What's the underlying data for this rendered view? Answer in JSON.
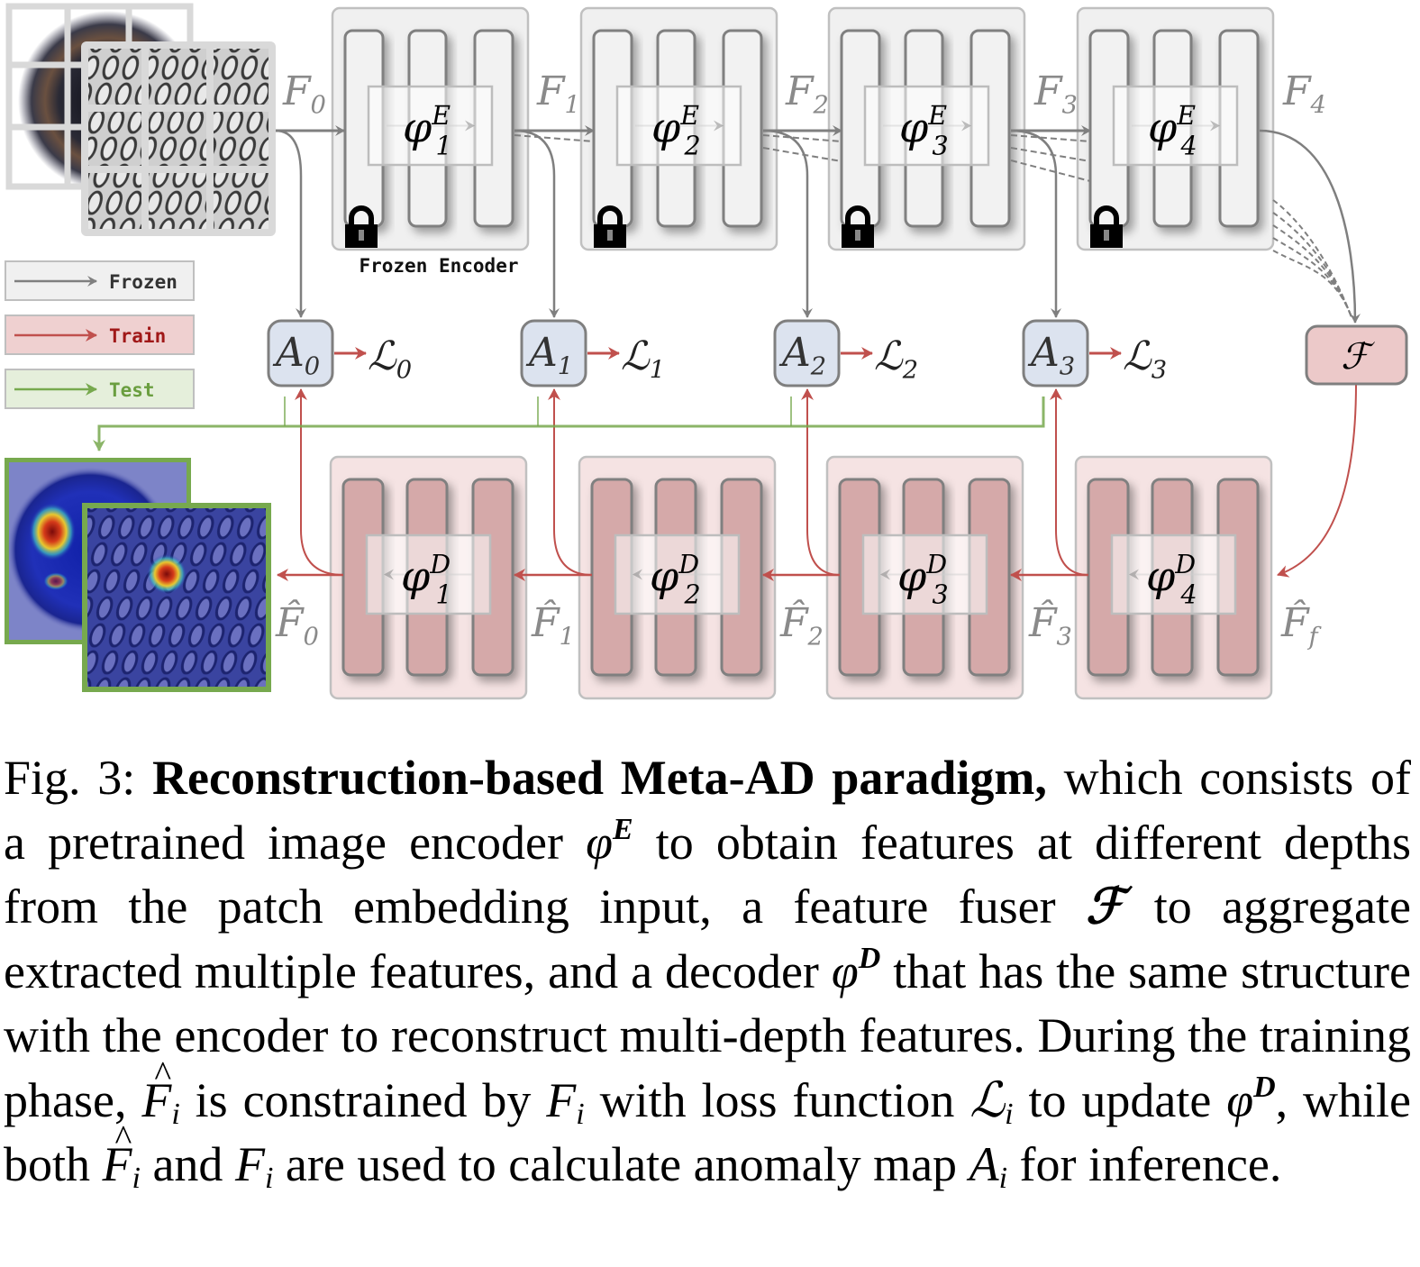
{
  "diagram": {
    "title_label": "Frozen Encoder",
    "legend": [
      {
        "label": "Frozen",
        "color": "#7f7f7f",
        "bg": "#f0f0f0",
        "text_color": "#333333"
      },
      {
        "label": "Train",
        "color": "#c0504d",
        "bg": "#efd0d0",
        "text_color": "#a01818"
      },
      {
        "label": "Test",
        "color": "#77a94e",
        "bg": "#e5efdb",
        "text_color": "#6a9e3f"
      }
    ],
    "encoder_blocks": [
      {
        "symbol": "φ",
        "sup": "E",
        "sub": "1",
        "locked": true
      },
      {
        "symbol": "φ",
        "sup": "E",
        "sub": "2",
        "locked": true
      },
      {
        "symbol": "φ",
        "sup": "E",
        "sub": "3",
        "locked": true
      },
      {
        "symbol": "φ",
        "sup": "E",
        "sub": "4",
        "locked": true
      }
    ],
    "decoder_blocks": [
      {
        "symbol": "φ",
        "sup": "D",
        "sub": "1"
      },
      {
        "symbol": "φ",
        "sup": "D",
        "sub": "2"
      },
      {
        "symbol": "φ",
        "sup": "D",
        "sub": "3"
      },
      {
        "symbol": "φ",
        "sup": "D",
        "sub": "4"
      }
    ],
    "encoder_features": [
      {
        "name": "F",
        "sub": "0"
      },
      {
        "name": "F",
        "sub": "1"
      },
      {
        "name": "F",
        "sub": "2"
      },
      {
        "name": "F",
        "sub": "3"
      },
      {
        "name": "F",
        "sub": "4"
      }
    ],
    "decoder_features": [
      {
        "name": "F̂",
        "sub": "0"
      },
      {
        "name": "F̂",
        "sub": "1"
      },
      {
        "name": "F̂",
        "sub": "2"
      },
      {
        "name": "F̂",
        "sub": "3"
      },
      {
        "name": "F̂",
        "sub": "f"
      }
    ],
    "anomaly_nodes": [
      {
        "name": "A",
        "sub": "0",
        "loss": "ℒ",
        "loss_sub": "0"
      },
      {
        "name": "A",
        "sub": "1",
        "loss": "ℒ",
        "loss_sub": "1"
      },
      {
        "name": "A",
        "sub": "2",
        "loss": "ℒ",
        "loss_sub": "2"
      },
      {
        "name": "A",
        "sub": "3",
        "loss": "ℒ",
        "loss_sub": "3"
      }
    ],
    "fuser": {
      "symbol": "ℱ"
    },
    "colors": {
      "encoder_box": "#f0f0f0",
      "decoder_box": "#f5e3e3",
      "decoder_bar": "#d5a9a9",
      "anomaly_node": "#dce3ef",
      "fuser_node": "#ecc9c9",
      "frozen_arrow": "#7f7f7f",
      "train_arrow": "#c0504d",
      "test_arrow": "#77a94e"
    }
  },
  "caption": {
    "fig_label": "Fig. 3:",
    "bold_title": "Reconstruction-based Meta-AD paradigm,",
    "seg1": " which consists of a pretrained image encoder ",
    "phiE": "φ",
    "phiE_sup": "E",
    "seg2": " to obtain features at different depths from the patch embedding input, a feature fuser ",
    "fuser": "ℱ",
    "seg3": " to aggregate extracted multiple features, and a decoder ",
    "phiD": "φ",
    "phiD_sup": "D",
    "seg4": " that has the same structure with the encoder to reconstruct multi-depth features. During the training phase, ",
    "Fhat": "F",
    "Fhat_sub": "i",
    "seg5": " is constrained by ",
    "F1": "F",
    "F1_sub": "i",
    "seg6": " with loss function ",
    "L": "ℒ",
    "L_sub": "i",
    "seg7": " to update ",
    "phiD2": "φ",
    "phiD2_sup": "D",
    "seg8": ", while both ",
    "Fhat2": "F",
    "Fhat2_sub": "i",
    "seg9": " and ",
    "F2": "F",
    "F2_sub": "i",
    "seg10": " are used to calculate anomaly map ",
    "A": "A",
    "A_sub": "i",
    "seg11": " for inference."
  }
}
